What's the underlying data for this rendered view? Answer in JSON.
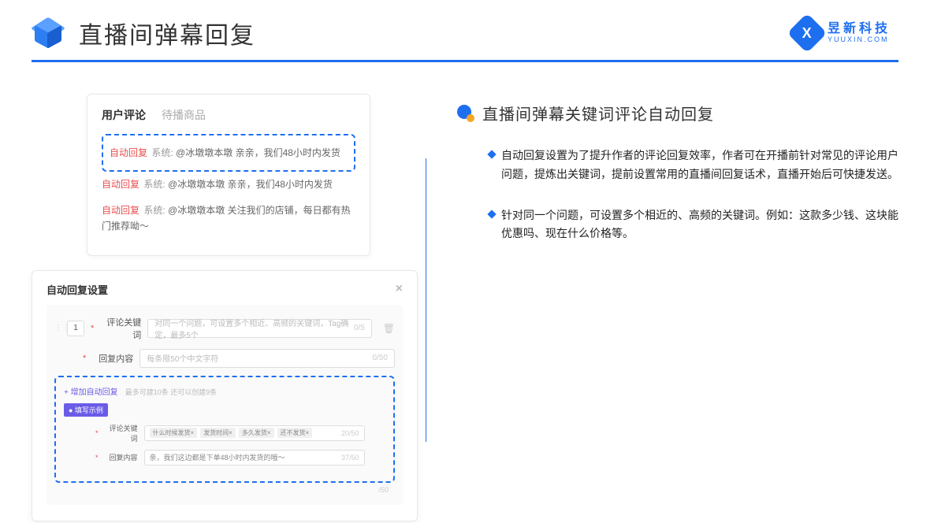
{
  "header": {
    "title": "直播间弹幕回复",
    "brand_name": "昱新科技",
    "brand_url": "YUUXIN.COM"
  },
  "comments_panel": {
    "tab_active": "用户评论",
    "tab_inactive": "待播商品",
    "auto_tag": "自动回复",
    "sys_tag": "系统:",
    "rows": [
      "@冰墩墩本墩 亲亲，我们48小时内发货",
      "@冰墩墩本墩 亲亲，我们48小时内发货",
      "@冰墩墩本墩 关注我们的店铺，每日都有热门推荐呦～"
    ]
  },
  "settings_panel": {
    "title": "自动回复设置",
    "index": "1",
    "field1_label": "评论关键词",
    "field1_placeholder": "对同一个问题，可设置多个相近、高频的关键词，Tag确定，最多5个",
    "field1_counter": "0/5",
    "field2_label": "回复内容",
    "field2_placeholder": "每条限50个中文字符",
    "field2_counter": "0/50",
    "add_link": "+ 增加自动回复",
    "add_hint": "最多可建10条 还可以创建9条",
    "example_badge": "● 填写示例",
    "ex_field1_label": "评论关键词",
    "ex_tags": [
      "什么时候发货×",
      "发货时间×",
      "多久发货×",
      "还不发货×"
    ],
    "ex_field1_counter": "20/50",
    "ex_field2_label": "回复内容",
    "ex_field2_value": "亲，我们这边都是下单48小时内发货的哦～",
    "ex_field2_counter": "37/50",
    "outer_counter": "/50"
  },
  "right": {
    "section_title": "直播间弹幕关键词评论自动回复",
    "bullets": [
      "自动回复设置为了提升作者的评论回复效率，作者可在开播前针对常见的评论用户问题，提炼出关键词，提前设置常用的直播间回复话术，直播开始后可快捷发送。",
      "针对同一个问题，可设置多个相近的、高频的关键词。例如：这款多少钱、这块能优惠吗、现在什么价格等。"
    ]
  }
}
